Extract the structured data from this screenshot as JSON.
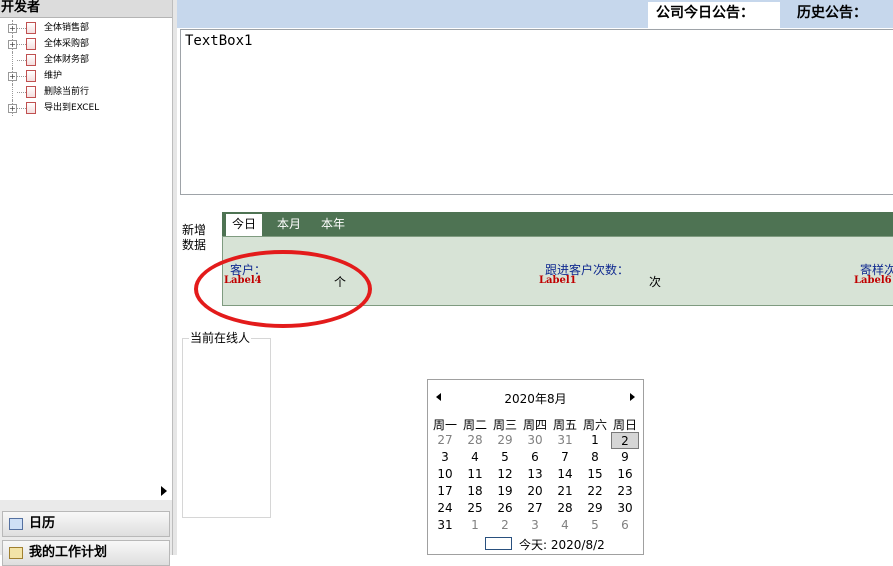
{
  "left_panel": {
    "title": "开发者",
    "tree_items": [
      {
        "label": "全体销售部",
        "expandable": true
      },
      {
        "label": "全体采购部",
        "expandable": true
      },
      {
        "label": "全体财务部",
        "expandable": false
      },
      {
        "label": "维护",
        "expandable": true
      },
      {
        "label": "删除当前行",
        "expandable": false
      },
      {
        "label": "导出到EXCEL",
        "expandable": true
      }
    ],
    "nav_buttons": [
      {
        "label": "日历",
        "icon": "calendar-icon"
      },
      {
        "label": "我的工作计划",
        "icon": "plan-icon"
      }
    ]
  },
  "header": {
    "announcement_tab": "公司今日公告：",
    "history_label": "历史公告："
  },
  "textbox": {
    "value": "TextBox1"
  },
  "new_data": {
    "label": "新增数据",
    "tabs": [
      "今日",
      "本月",
      "本年"
    ],
    "active_tab": 0,
    "stats": {
      "customers_label": "客户：",
      "customers_value": "Label4",
      "customers_unit": "个",
      "followups_label": "跟进客户次数：",
      "followups_value": "Label1",
      "followups_unit": "次",
      "samples_label": "寄样次",
      "samples_value": "Label6"
    }
  },
  "online": {
    "label": "当前在线人"
  },
  "calendar": {
    "month_label": "2020年8月",
    "weekdays": [
      "周一",
      "周二",
      "周三",
      "周四",
      "周五",
      "周六",
      "周日"
    ],
    "weeks": [
      [
        "27",
        "28",
        "29",
        "30",
        "31",
        "1",
        "2"
      ],
      [
        "3",
        "4",
        "5",
        "6",
        "7",
        "8",
        "9"
      ],
      [
        "10",
        "11",
        "12",
        "13",
        "14",
        "15",
        "16"
      ],
      [
        "17",
        "18",
        "19",
        "20",
        "21",
        "22",
        "23"
      ],
      [
        "24",
        "25",
        "26",
        "27",
        "28",
        "29",
        "30"
      ],
      [
        "31",
        "1",
        "2",
        "3",
        "4",
        "5",
        "6"
      ]
    ],
    "other_month_days": [
      [
        0,
        0
      ],
      [
        0,
        1
      ],
      [
        0,
        2
      ],
      [
        0,
        3
      ],
      [
        0,
        4
      ],
      [
        5,
        1
      ],
      [
        5,
        2
      ],
      [
        5,
        3
      ],
      [
        5,
        4
      ],
      [
        5,
        5
      ],
      [
        5,
        6
      ]
    ],
    "selected_day": [
      0,
      6
    ],
    "today_text": "今天: 2020/8/2"
  },
  "colors": {
    "header_bg": "#c6d7ec",
    "tab_strip_bg": "#4e7353",
    "stats_bg": "#d7e3d6",
    "label_blue": "#102a90",
    "value_red": "#c00000",
    "annotation_red": "#e31b1b"
  }
}
